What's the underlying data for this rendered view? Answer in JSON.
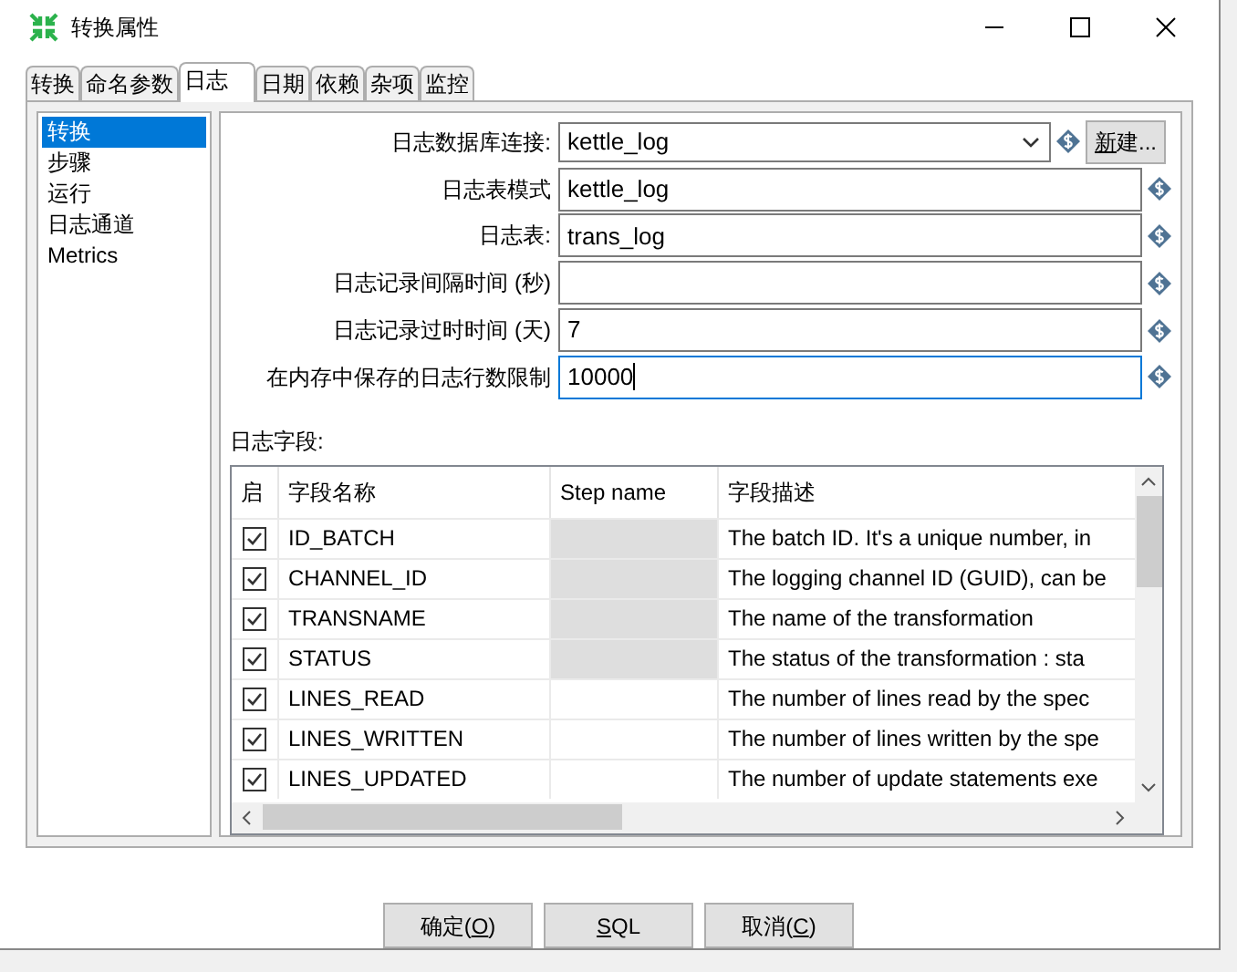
{
  "window": {
    "title": "转换属性"
  },
  "tabs": [
    {
      "label": "转换",
      "selected": false
    },
    {
      "label": "命名参数",
      "selected": false
    },
    {
      "label": "日志",
      "selected": true
    },
    {
      "label": "日期",
      "selected": false
    },
    {
      "label": "依赖",
      "selected": false
    },
    {
      "label": "杂项",
      "selected": false
    },
    {
      "label": "监控",
      "selected": false
    }
  ],
  "sidebar": {
    "items": [
      {
        "label": "转换",
        "selected": true
      },
      {
        "label": "步骤",
        "selected": false
      },
      {
        "label": "运行",
        "selected": false
      },
      {
        "label": "日志通道",
        "selected": false
      },
      {
        "label": "Metrics",
        "selected": false
      }
    ]
  },
  "form": {
    "fields": [
      {
        "kind": "dropdown",
        "label": "日志数据库连接:",
        "value": "kettle_log",
        "focused": false
      },
      {
        "kind": "text",
        "label": "日志表模式",
        "value": "kettle_log",
        "focused": false
      },
      {
        "kind": "text",
        "label": "日志表:",
        "value": "trans_log",
        "focused": false
      },
      {
        "kind": "text",
        "label": "日志记录间隔时间 (秒)",
        "focused": false
      },
      {
        "kind": "text",
        "label": "日志记录过时时间 (天)",
        "value": "7",
        "focused": false
      },
      {
        "kind": "text",
        "label": "在内存中保存的日志行数限制",
        "value": "10000",
        "focused": true
      }
    ],
    "new_button": {
      "key": "新",
      "after": "建..."
    }
  },
  "log_fields": {
    "title": "日志字段:",
    "columns": [
      "启",
      "字段名称",
      "Step name",
      "字段描述"
    ],
    "rows": [
      {
        "checked": true,
        "name": "ID_BATCH",
        "step_disabled": true,
        "description": "The batch ID. It's a unique number, in"
      },
      {
        "checked": true,
        "name": "CHANNEL_ID",
        "step_disabled": true,
        "description": "The logging channel ID (GUID), can be"
      },
      {
        "checked": true,
        "name": "TRANSNAME",
        "step_disabled": true,
        "description": "The name of the transformation"
      },
      {
        "checked": true,
        "name": "STATUS",
        "step_disabled": true,
        "description": "The status of the transformation : sta"
      },
      {
        "checked": true,
        "name": "LINES_READ",
        "step_disabled": false,
        "description": "The number of lines read by the spec"
      },
      {
        "checked": true,
        "name": "LINES_WRITTEN",
        "step_disabled": false,
        "description": "The number of lines written by the spe"
      },
      {
        "checked": true,
        "name": "LINES_UPDATED",
        "step_disabled": false,
        "description": "The number of update statements exe"
      }
    ]
  },
  "buttons": [
    {
      "before": "确定(",
      "key": "O",
      "after": ")"
    },
    {
      "key": "S",
      "after": "QL"
    },
    {
      "before": "取消(",
      "key": "C",
      "after": ")"
    }
  ]
}
